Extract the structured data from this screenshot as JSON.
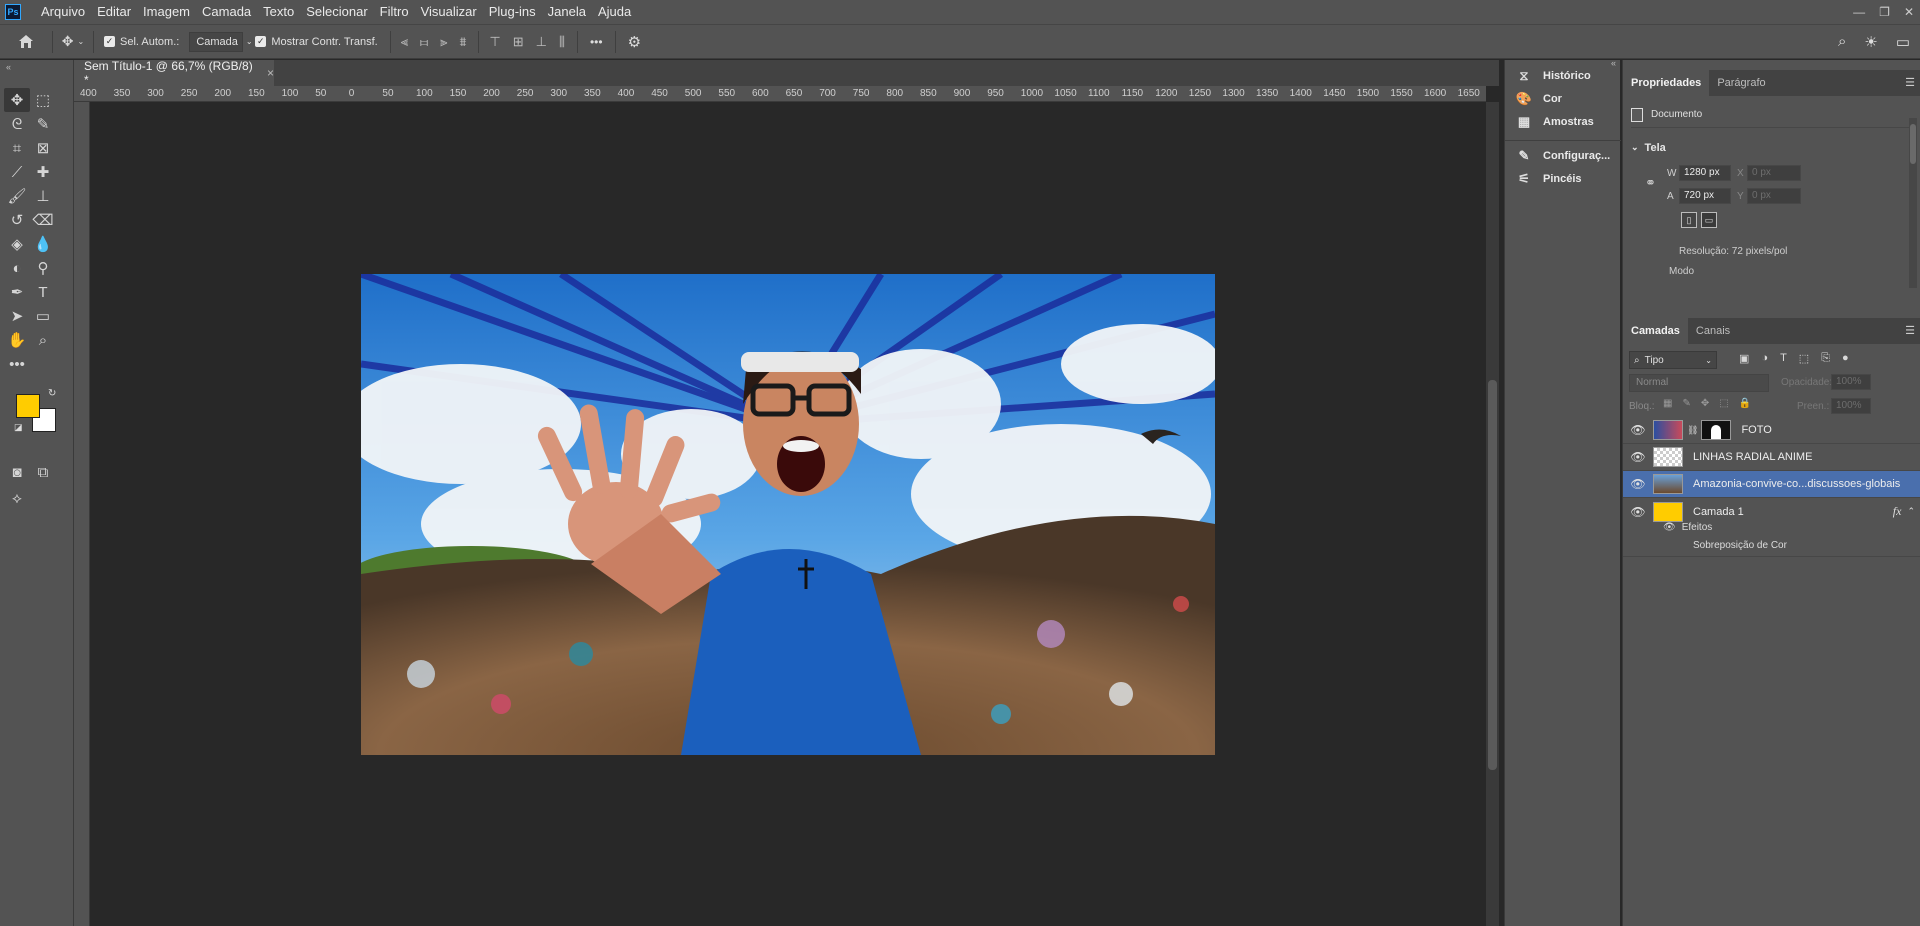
{
  "app": {
    "logo_text": "Ps"
  },
  "menu": [
    "Arquivo",
    "Editar",
    "Imagem",
    "Camada",
    "Texto",
    "Selecionar",
    "Filtro",
    "Visualizar",
    "Plug-ins",
    "Janela",
    "Ajuda"
  ],
  "options_bar": {
    "auto_select_label": "Sel. Autom.:",
    "auto_select_target": "Camada",
    "show_transform_label": "Mostrar Contr. Transf.",
    "more": "•••"
  },
  "document": {
    "tab_title": "Sem Título-1 @ 66,7% (RGB/8) *",
    "close": "×"
  },
  "ruler": {
    "top_ticks": [
      "400",
      "350",
      "300",
      "250",
      "200",
      "150",
      "100",
      "50",
      "0",
      "50",
      "100",
      "150",
      "200",
      "250",
      "300",
      "350",
      "400",
      "450",
      "500",
      "550",
      "600",
      "650",
      "700",
      "750",
      "800",
      "850",
      "900",
      "950",
      "1000",
      "1050",
      "1100",
      "1150",
      "1200",
      "1250",
      "1300",
      "1350",
      "1400",
      "1450",
      "1500",
      "1550",
      "1600",
      "1650"
    ]
  },
  "dock": {
    "items": [
      {
        "label": "Histórico",
        "icon": "history-icon"
      },
      {
        "label": "Cor",
        "icon": "color-palette-icon"
      },
      {
        "label": "Amostras",
        "icon": "swatches-grid-icon"
      },
      {
        "label": "Configuraç...",
        "icon": "brush-settings-icon"
      },
      {
        "label": "Pincéis",
        "icon": "brushes-icon"
      }
    ]
  },
  "properties": {
    "tabs": [
      "Propriedades",
      "Parágrafo"
    ],
    "doc_label": "Documento",
    "section": "Tela",
    "w_label": "W",
    "w_value": "1280 px",
    "h_label": "A",
    "h_value": "720 px",
    "x_label": "X",
    "x_placeholder": "0 px",
    "y_label": "Y",
    "y_placeholder": "0 px",
    "resolution": "Resolução: 72 pixels/pol",
    "mode_label": "Modo"
  },
  "layers": {
    "tabs": [
      "Camadas",
      "Canais"
    ],
    "filter_label": "Tipo",
    "blend_mode": "Normal",
    "opacity_label": "Opacidade:",
    "opacity_value": "100%",
    "lock_label": "Bloq.:",
    "fill_label": "Preen.:",
    "fill_value": "100%",
    "rows": [
      {
        "name": "FOTO"
      },
      {
        "name": "LINHAS RADIAL ANIME"
      },
      {
        "name": "Amazonia-convive-co...discussoes-globais"
      },
      {
        "name": "Camada 1"
      }
    ],
    "effects_label": "Efeitos",
    "effect_name": "Sobreposição de Cor",
    "fx": "fx"
  },
  "colors": {
    "foreground": "#ffcc00",
    "background": "#ffffff",
    "selected_row": "#4a6fad"
  }
}
